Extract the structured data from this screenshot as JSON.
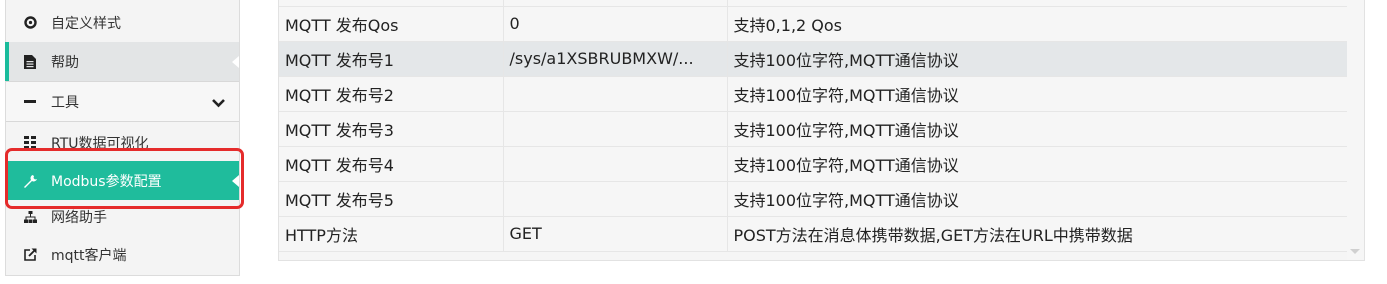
{
  "sidebar": {
    "items": [
      {
        "label": "自定义样式",
        "icon": "custom-style-icon"
      },
      {
        "label": "帮助",
        "icon": "document-icon"
      },
      {
        "label": "工具",
        "icon": "minus-icon",
        "expand_icon": "chevron-down-icon"
      },
      {
        "label": "RTU数据可视化",
        "icon": "grid-icon"
      },
      {
        "label": "Modbus参数配置",
        "icon": "wrench-icon"
      },
      {
        "label": "网络助手",
        "icon": "network-icon"
      },
      {
        "label": "mqtt客户端",
        "icon": "external-link-icon"
      }
    ],
    "active_color": "#1fbc9c",
    "highlight_color": "#e52b2b"
  },
  "table": {
    "rows": [
      {
        "name": "MQTT 发布Qos",
        "value": "0",
        "desc": "支持0,1,2 Qos"
      },
      {
        "name": "MQTT 发布号1",
        "value": "/sys/a1XSBRUBMXW/...",
        "desc": "支持100位字符,MQTT通信协议"
      },
      {
        "name": "MQTT 发布号2",
        "value": "",
        "desc": "支持100位字符,MQTT通信协议"
      },
      {
        "name": "MQTT 发布号3",
        "value": "",
        "desc": "支持100位字符,MQTT通信协议"
      },
      {
        "name": "MQTT 发布号4",
        "value": "",
        "desc": "支持100位字符,MQTT通信协议"
      },
      {
        "name": "MQTT 发布号5",
        "value": "",
        "desc": "支持100位字符,MQTT通信协议"
      },
      {
        "name": "HTTP方法",
        "value": "GET",
        "desc": "POST方法在消息体携带数据,GET方法在URL中携带数据"
      }
    ]
  }
}
